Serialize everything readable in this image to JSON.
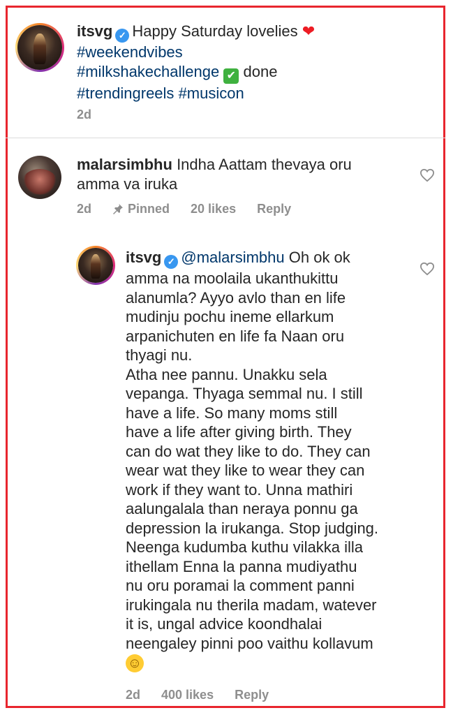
{
  "post": {
    "username": "itsvg",
    "caption_text": "Happy Saturday lovelies",
    "heart": "❤",
    "tag1": "#weekendvibes",
    "tag2": "#milkshakechallenge",
    "check": "✔",
    "done_text": "done",
    "tag3": "#trendingreels",
    "tag4": "#musicon",
    "time": "2d"
  },
  "comment1": {
    "username": "malarsimbhu",
    "text_line1": "Indha Aattam thevaya oru",
    "text_line2": "amma va iruka",
    "time": "2d",
    "pinned": "Pinned",
    "likes": "20 likes",
    "reply": "Reply"
  },
  "reply1": {
    "username": "itsvg",
    "mention": "@malarsimbhu",
    "lines": [
      "Oh ok ok",
      "amma na moolaila ukanthukittu",
      "alanumla? Ayyo avlo than en life",
      "mudinju pochu ineme ellarkum",
      "arpanichuten en life fa Naan oru",
      "thyagi nu.",
      "Atha nee pannu. Unakku sela",
      "vepanga. Thyaga semmal nu. I still",
      "have a life. So many moms still",
      "have a life after giving birth. They",
      "can do wat they like to do. They can",
      "wear wat they like to wear they can",
      "work if they want to. Unna mathiri",
      "aalungalala than neraya ponnu ga",
      "depression la irukanga. Stop judging.",
      "Neenga kudumba kuthu vilakka illa",
      "ithellam Enna la panna mudiyathu",
      "nu oru poramai la comment panni",
      "irukingala nu therila madam, watever",
      "it is, ungal advice koondhalai",
      "neengaley pinni poo vaithu kollavum"
    ],
    "smile": "☺",
    "time": "2d",
    "likes": "400 likes",
    "reply": "Reply"
  },
  "colors": {
    "border_red": "#e8262e",
    "hashtag_blue": "#00376b",
    "meta_gray": "#8e8e8e",
    "verified_blue": "#3897f0"
  },
  "icons": {
    "verified": "verified-badge-icon",
    "like": "heart-outline-icon",
    "pin": "pin-icon"
  }
}
